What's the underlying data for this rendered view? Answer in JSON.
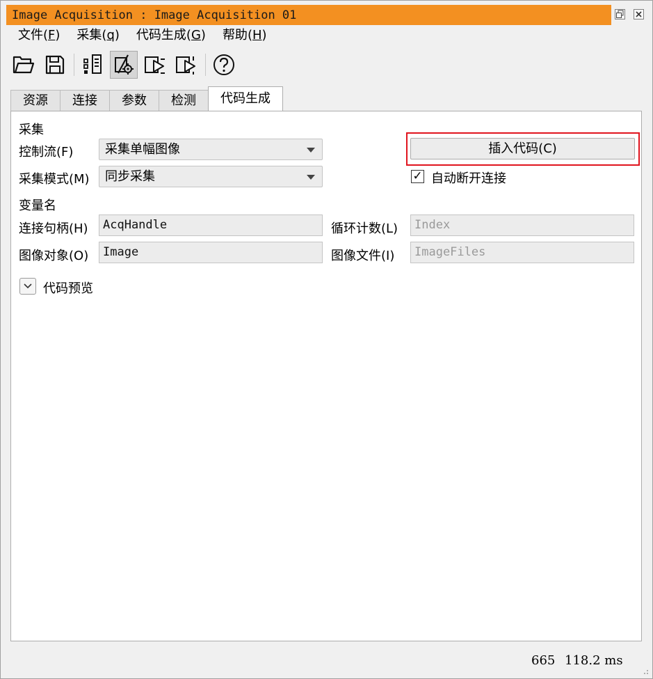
{
  "window": {
    "title": "Image Acquisition : Image Acquisition 01",
    "restore_icon": "restore-icon",
    "close_icon": "close-icon"
  },
  "menu": [
    {
      "label": "文件",
      "mnemonic": "F"
    },
    {
      "label": "采集",
      "mnemonic": "q"
    },
    {
      "label": "代码生成",
      "mnemonic": "G"
    },
    {
      "label": "帮助",
      "mnemonic": "H"
    }
  ],
  "toolbar": {
    "icons": [
      "folder-open-icon",
      "save-icon",
      "detect-icon",
      "connect-settings-icon",
      "snap-icon",
      "live-icon",
      "help-icon"
    ],
    "active": "connect-settings-icon"
  },
  "tabs": {
    "items": [
      "资源",
      "连接",
      "参数",
      "检测",
      "代码生成"
    ],
    "active_index": 4
  },
  "codegen": {
    "acquisition_heading": "采集",
    "control_flow_label": "控制流(F)",
    "control_flow_value": "采集单幅图像",
    "mode_label": "采集模式(M)",
    "mode_value": "同步采集",
    "insert_button": "插入代码(C)",
    "auto_disconnect_label": "自动断开连接",
    "auto_disconnect_checked": true,
    "variables_heading": "变量名",
    "handle_label": "连接句柄(H)",
    "handle_value": "AcqHandle",
    "loop_label": "循环计数(L)",
    "loop_value": "Index",
    "image_label": "图像对象(O)",
    "image_value": "Image",
    "files_label": "图像文件(I)",
    "files_value": "ImageFiles",
    "preview_label": "代码预览"
  },
  "status": {
    "count": "665",
    "time": "118.2 ms"
  },
  "colors": {
    "title_bar": "#f39021",
    "highlight": "#e0141e"
  }
}
